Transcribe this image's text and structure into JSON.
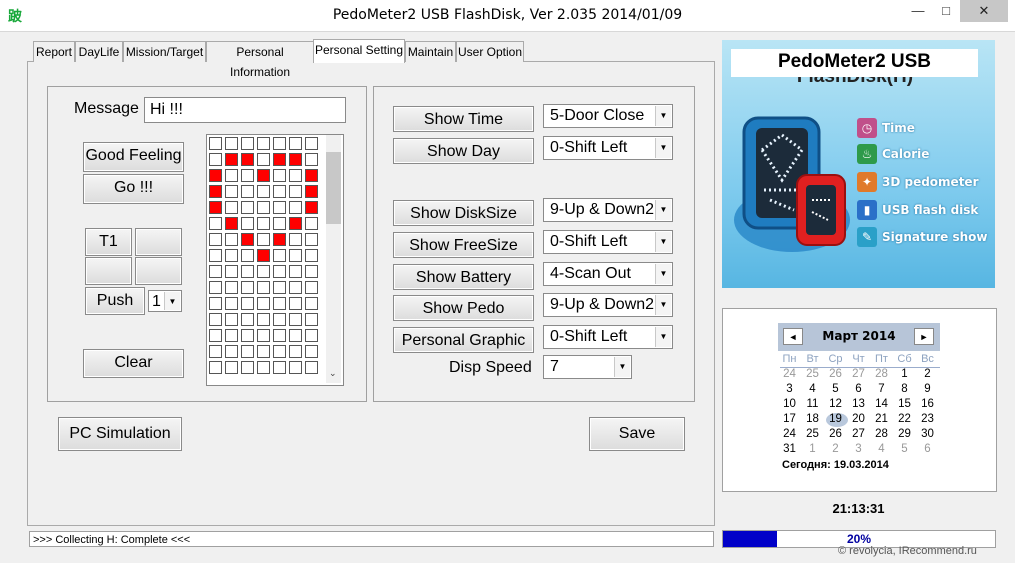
{
  "window": {
    "title": "PedoMeter2 USB FlashDisk, Ver 2.035  2014/01/09",
    "app_icon": "跛",
    "min": "—",
    "max": "□",
    "close": "✕"
  },
  "tabs": [
    "Report",
    "DayLife",
    "Mission/Target",
    "Personal Information",
    "Personal Setting",
    "Maintain",
    "User Option"
  ],
  "active_tab": "Personal Setting",
  "left": {
    "message_label": "Message",
    "message_value": "Hi !!!",
    "good_feeling": "Good Feeling",
    "go": "Go !!!",
    "t1": "T1",
    "push": "Push",
    "push_select": "1",
    "clear": "Clear",
    "pc_simulation": "PC Simulation",
    "grid_rows": [
      [
        0,
        0,
        0,
        0,
        0,
        0,
        0
      ],
      [
        0,
        1,
        1,
        0,
        1,
        1,
        0
      ],
      [
        1,
        0,
        0,
        1,
        0,
        0,
        1
      ],
      [
        1,
        0,
        0,
        0,
        0,
        0,
        1
      ],
      [
        1,
        0,
        0,
        0,
        0,
        0,
        1
      ],
      [
        0,
        1,
        0,
        0,
        0,
        1,
        0
      ],
      [
        0,
        0,
        1,
        0,
        1,
        0,
        0
      ],
      [
        0,
        0,
        0,
        1,
        0,
        0,
        0
      ],
      [
        0,
        0,
        0,
        0,
        0,
        0,
        0
      ],
      [
        0,
        0,
        0,
        0,
        0,
        0,
        0
      ],
      [
        0,
        0,
        0,
        0,
        0,
        0,
        0
      ],
      [
        0,
        0,
        0,
        0,
        0,
        0,
        0
      ],
      [
        0,
        0,
        0,
        0,
        0,
        0,
        0
      ],
      [
        0,
        0,
        0,
        0,
        0,
        0,
        0
      ],
      [
        0,
        0,
        0,
        0,
        0,
        0,
        0
      ]
    ]
  },
  "settings": [
    {
      "button": "Show Time",
      "value": "5-Door Close"
    },
    {
      "button": "Show Day",
      "value": "0-Shift Left"
    },
    {
      "button": "Show DiskSize",
      "value": "9-Up & Down2"
    },
    {
      "button": "Show FreeSize",
      "value": "0-Shift Left"
    },
    {
      "button": "Show Battery",
      "value": "4-Scan Out"
    },
    {
      "button": "Show Pedo",
      "value": "9-Up & Down2"
    },
    {
      "button": "Personal Graphic",
      "value": "0-Shift Left"
    }
  ],
  "disp_speed": {
    "label": "Disp Speed",
    "value": "7"
  },
  "save": "Save",
  "ad": {
    "title": "PedoMeter2 USB",
    "title2": "FlashDisk(H)",
    "features": [
      {
        "icon": "clock-icon",
        "glyph": "◷",
        "color": "#c0508a",
        "label": "Time"
      },
      {
        "icon": "flame-icon",
        "glyph": "♨",
        "color": "#2e9a4a",
        "label": "Calorie"
      },
      {
        "icon": "walker-icon",
        "glyph": "✦",
        "color": "#e07a2a",
        "label": "3D pedometer"
      },
      {
        "icon": "usb-icon",
        "glyph": "▮",
        "color": "#2a70c8",
        "label": "USB flash disk"
      },
      {
        "icon": "signature-icon",
        "glyph": "✎",
        "color": "#2aa0c8",
        "label": "Signature show"
      }
    ]
  },
  "calendar": {
    "month": "Март 2014",
    "prev": "◄",
    "next": "►",
    "weekdays": [
      "Пн",
      "Вт",
      "Ср",
      "Чт",
      "Пт",
      "Сб",
      "Вс"
    ],
    "weeks": [
      [
        "24",
        "25",
        "26",
        "27",
        "28",
        "1",
        "2"
      ],
      [
        "3",
        "4",
        "5",
        "6",
        "7",
        "8",
        "9"
      ],
      [
        "10",
        "11",
        "12",
        "13",
        "14",
        "15",
        "16"
      ],
      [
        "17",
        "18",
        "19",
        "20",
        "21",
        "22",
        "23"
      ],
      [
        "24",
        "25",
        "26",
        "27",
        "28",
        "29",
        "30"
      ],
      [
        "31",
        "1",
        "2",
        "3",
        "4",
        "5",
        "6"
      ]
    ],
    "gray_first_row": 5,
    "gray_last_row_from": 1,
    "today_label": "Сегодня: 19.03.2014",
    "selected": "19"
  },
  "clock": "21:13:31",
  "status": ">>> Collecting H: Complete <<<",
  "progress": {
    "percent": 20,
    "label": "20%"
  },
  "watermark": "© revolycia, IRecommend.ru"
}
